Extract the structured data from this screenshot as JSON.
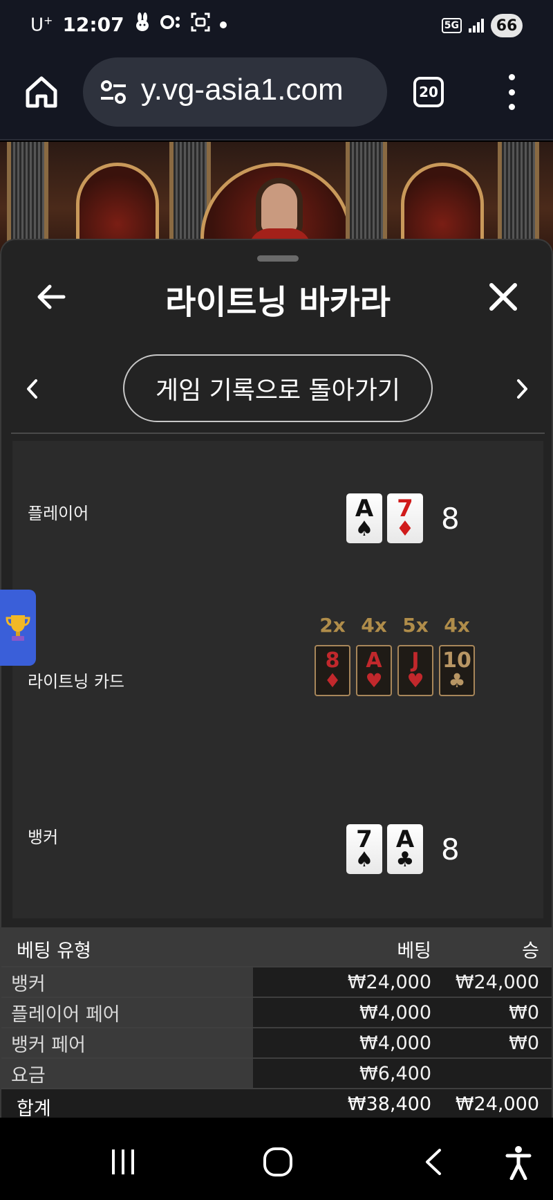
{
  "status_bar": {
    "carrier": "U",
    "carrier_sup": "+",
    "time": "12:07",
    "network": "5G",
    "battery": "66"
  },
  "browser": {
    "url": "y.vg-asia1.com",
    "tab_count": "20"
  },
  "modal": {
    "title": "라이트닝 바카라",
    "back_to_history": "게임 기록으로 돌아가기"
  },
  "result": {
    "player": {
      "label": "플레이어",
      "cards": [
        {
          "rank": "A",
          "suit": "♠",
          "color": "black"
        },
        {
          "rank": "7",
          "suit": "♦",
          "color": "red"
        }
      ],
      "score": "8"
    },
    "lightning": {
      "label": "라이트닝 카드",
      "cards": [
        {
          "mult": "2x",
          "rank": "8",
          "suit": "♦",
          "color": "red"
        },
        {
          "mult": "4x",
          "rank": "A",
          "suit": "♥",
          "color": "red"
        },
        {
          "mult": "5x",
          "rank": "J",
          "suit": "♥",
          "color": "red"
        },
        {
          "mult": "4x",
          "rank": "10",
          "suit": "♣",
          "color": "gold"
        }
      ]
    },
    "banker": {
      "label": "뱅커",
      "cards": [
        {
          "rank": "7",
          "suit": "♠",
          "color": "black"
        },
        {
          "rank": "A",
          "suit": "♣",
          "color": "black"
        }
      ],
      "score": "8"
    }
  },
  "bet_table": {
    "headers": [
      "베팅 유형",
      "베팅",
      "승"
    ],
    "rows": [
      {
        "type": "뱅커",
        "bet": "₩24,000",
        "win": "₩24,000"
      },
      {
        "type": "플레이어 페어",
        "bet": "₩4,000",
        "win": "₩0"
      },
      {
        "type": "뱅커 페어",
        "bet": "₩4,000",
        "win": "₩0"
      },
      {
        "type": "요금",
        "bet": "₩6,400",
        "win": ""
      }
    ],
    "total": {
      "label": "합계",
      "bet": "₩38,400",
      "win": "₩24,000"
    }
  }
}
